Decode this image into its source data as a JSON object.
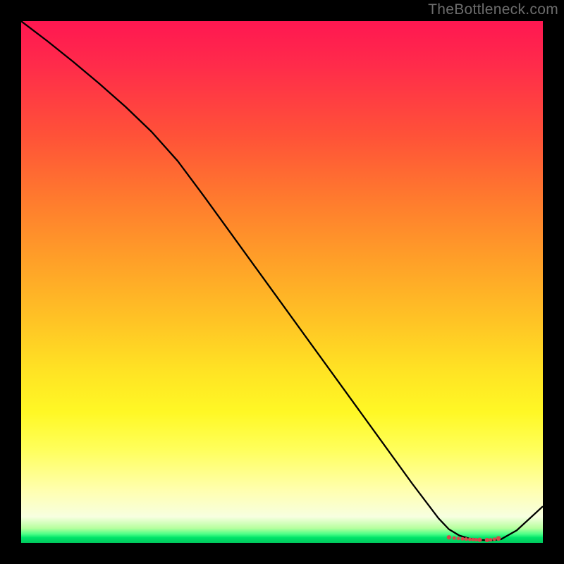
{
  "watermark": "TheBottleneck.com",
  "chart_data": {
    "type": "line",
    "title": "",
    "xlabel": "",
    "ylabel": "",
    "xlim": [
      0,
      100
    ],
    "ylim": [
      0,
      100
    ],
    "x": [
      0,
      5,
      10,
      15,
      20,
      25,
      30,
      35,
      40,
      45,
      50,
      55,
      60,
      65,
      70,
      75,
      80,
      82,
      84,
      86,
      88,
      90,
      92,
      95,
      100
    ],
    "values": [
      100,
      96.2,
      92.2,
      88.0,
      83.6,
      78.8,
      73.2,
      66.5,
      59.6,
      52.7,
      45.8,
      38.9,
      32.0,
      25.1,
      18.2,
      11.3,
      4.7,
      2.6,
      1.4,
      0.8,
      0.55,
      0.5,
      0.7,
      2.4,
      7.0
    ],
    "markers_x": [
      82.0,
      83.0,
      83.8,
      84.6,
      85.3,
      86.0,
      86.6,
      87.2,
      87.9,
      89.3,
      90.0,
      90.7,
      91.5
    ],
    "markers_y": [
      1.05,
      0.92,
      0.84,
      0.77,
      0.72,
      0.68,
      0.64,
      0.61,
      0.58,
      0.55,
      0.59,
      0.69,
      0.86
    ],
    "marker_sizes": [
      3.1,
      2.6,
      2.5,
      2.5,
      2.5,
      2.5,
      2.5,
      2.5,
      3.1,
      3.1,
      2.5,
      2.5,
      3.3
    ],
    "gradient_stops": [
      {
        "pos": 0,
        "color": "#ff1751"
      },
      {
        "pos": 50,
        "color": "#ffb427"
      },
      {
        "pos": 80,
        "color": "#ffff55"
      },
      {
        "pos": 100,
        "color": "#00c85c"
      }
    ]
  }
}
